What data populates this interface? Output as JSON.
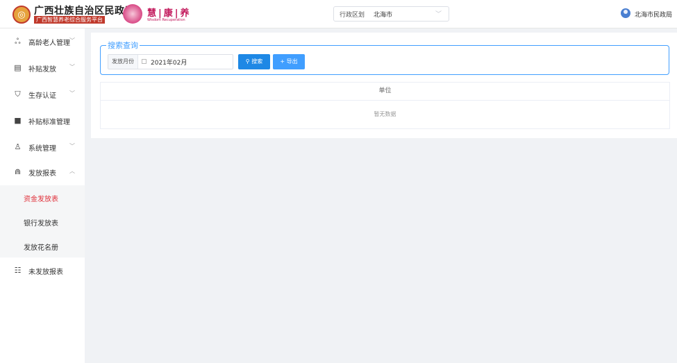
{
  "header": {
    "org_title": "广西壮族自治区民政厅",
    "org_subtitle": "广西智慧养老综合服务平台",
    "brand_name": "慧|康|养",
    "brand_en": "Wisdom Recuperation",
    "region_label": "行政区划",
    "region_value": "北海市",
    "user_name": "北海市民政局"
  },
  "sidebar": {
    "items": [
      {
        "label": "高龄老人管理",
        "icon": "group-icon"
      },
      {
        "label": "补贴发放",
        "icon": "document-icon"
      },
      {
        "label": "生存认证",
        "icon": "shield-icon"
      },
      {
        "label": "补贴标准管理",
        "icon": "book-icon"
      },
      {
        "label": "系统管理",
        "icon": "users-icon"
      },
      {
        "label": "发放报表",
        "icon": "chart-icon"
      },
      {
        "label": "未发放报表",
        "icon": "table-icon"
      }
    ],
    "submenu": [
      {
        "label": "资金发放表",
        "active": true
      },
      {
        "label": "银行发放表",
        "active": false
      },
      {
        "label": "发放花名册",
        "active": false
      }
    ]
  },
  "search": {
    "legend": "搜索查询",
    "month_label": "发放月份",
    "month_value": "2021年02月",
    "search_button": "搜索",
    "export_button": "导出"
  },
  "table": {
    "column": "单位",
    "empty_text": "暂无数据"
  },
  "colors": {
    "accent": "#409eff",
    "active_menu": "#e0303a"
  }
}
